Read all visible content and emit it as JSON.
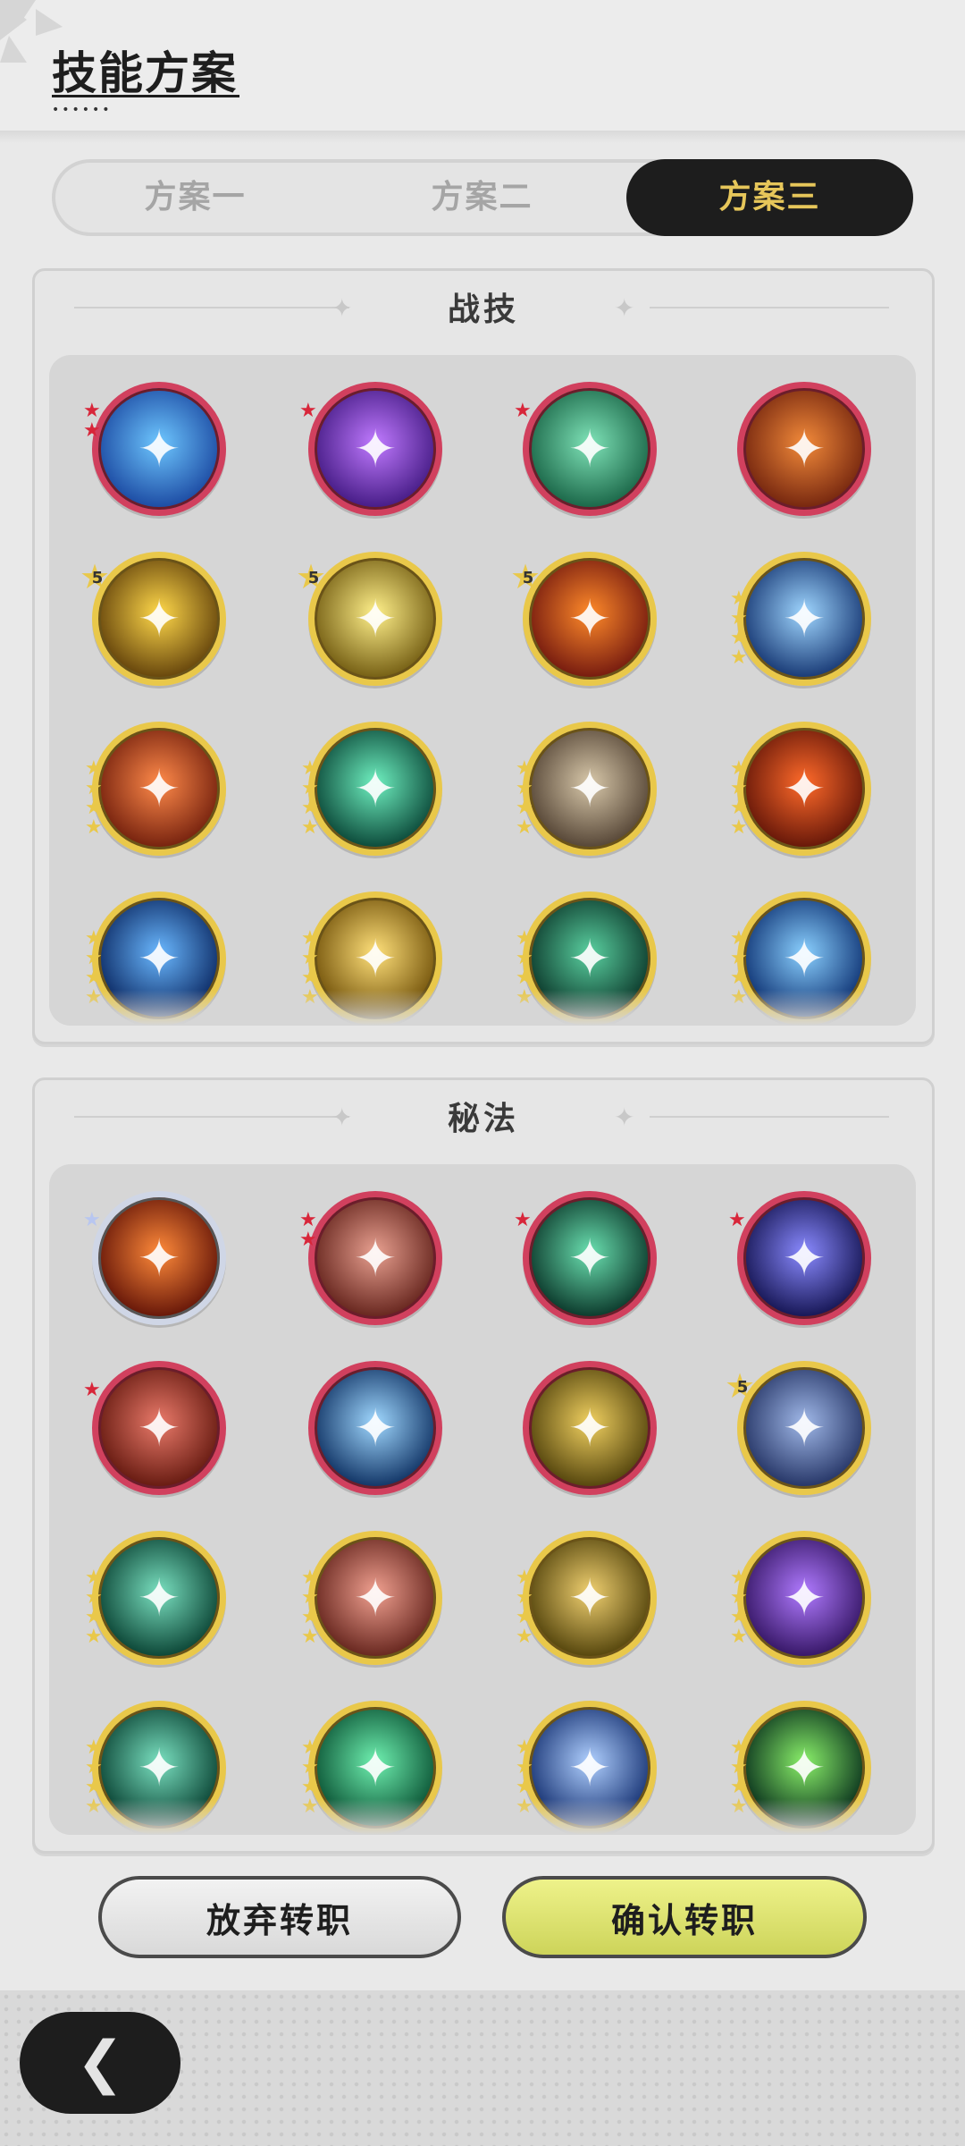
{
  "header": {
    "title": "技能方案"
  },
  "tabs": [
    {
      "label": "方案一",
      "active": false
    },
    {
      "label": "方案二",
      "active": false
    },
    {
      "label": "方案三",
      "active": true
    }
  ],
  "sections": {
    "combat": {
      "title": "战技",
      "skills": [
        {
          "name": "water-wave-skill-icon",
          "ring": "red",
          "badge": "red-star-2",
          "colors": [
            "#1f4fa6",
            "#6ec7ff"
          ]
        },
        {
          "name": "purple-lightning-skill-icon",
          "ring": "red",
          "badge": "red-star-1",
          "colors": [
            "#4a1f8a",
            "#c07aff"
          ]
        },
        {
          "name": "wind-vortex-skill-icon",
          "ring": "red",
          "badge": "red-star-1",
          "colors": [
            "#1e6b4c",
            "#7fe3b8"
          ]
        },
        {
          "name": "lava-burst-skill-icon",
          "ring": "red",
          "badge": "none",
          "colors": [
            "#7a2a10",
            "#f28a3a"
          ]
        },
        {
          "name": "golden-spike-skill-icon",
          "ring": "gold",
          "badge": "5",
          "colors": [
            "#6b4a0e",
            "#ffd84a"
          ]
        },
        {
          "name": "radiant-burst-skill-icon",
          "ring": "gold",
          "badge": "5",
          "colors": [
            "#7a6418",
            "#fff08a"
          ]
        },
        {
          "name": "fire-blast-skill-icon",
          "ring": "gold",
          "badge": "5",
          "colors": [
            "#7a1e10",
            "#ff8a2a"
          ]
        },
        {
          "name": "ice-shard-skill-icon",
          "ring": "gold",
          "badge": "gold-stars",
          "colors": [
            "#1d3f7a",
            "#9fd6ff"
          ]
        },
        {
          "name": "flame-eye-skill-icon",
          "ring": "gold",
          "badge": "gold-stars",
          "colors": [
            "#7a2510",
            "#ff8a4a"
          ]
        },
        {
          "name": "green-slash-skill-icon",
          "ring": "gold",
          "badge": "gold-stars",
          "colors": [
            "#0f4f3e",
            "#6ff0c0"
          ]
        },
        {
          "name": "rock-cards-skill-icon",
          "ring": "gold",
          "badge": "gold-stars",
          "colors": [
            "#5a4a3a",
            "#d8c8aa"
          ]
        },
        {
          "name": "fireball-skill-icon",
          "ring": "gold",
          "badge": "gold-stars",
          "colors": [
            "#6b1a0a",
            "#ff6a2a"
          ]
        },
        {
          "name": "blue-flame-skill-icon",
          "ring": "gold",
          "badge": "gold-stars",
          "colors": [
            "#10306b",
            "#6ab8ff"
          ]
        },
        {
          "name": "light-burst-skill-icon",
          "ring": "gold",
          "badge": "gold-stars",
          "colors": [
            "#7a5a10",
            "#ffe07a"
          ]
        },
        {
          "name": "thorn-vine-skill-icon",
          "ring": "gold",
          "badge": "gold-stars",
          "colors": [
            "#0f3f30",
            "#5ad0a0"
          ]
        },
        {
          "name": "crystal-shard-skill-icon",
          "ring": "gold",
          "badge": "gold-stars",
          "colors": [
            "#143a7a",
            "#8ad0ff"
          ]
        }
      ]
    },
    "arcane": {
      "title": "秘法",
      "skills": [
        {
          "name": "fire-orb-skill-icon",
          "ring": "silver",
          "badge": "silver-star",
          "colors": [
            "#6b1a0a",
            "#ff8a3a"
          ]
        },
        {
          "name": "healing-figure-skill-icon",
          "ring": "red",
          "badge": "red-star-2",
          "colors": [
            "#6b2a22",
            "#e8a090"
          ]
        },
        {
          "name": "green-spikes-skill-icon",
          "ring": "red",
          "badge": "red-star-1",
          "colors": [
            "#0f3f30",
            "#6ae0b0"
          ]
        },
        {
          "name": "clock-orb-skill-icon",
          "ring": "red",
          "badge": "red-star-1",
          "colors": [
            "#1a1a5a",
            "#8a8aff"
          ]
        },
        {
          "name": "demon-face-skill-icon",
          "ring": "red",
          "badge": "red-star-1",
          "colors": [
            "#6b1e14",
            "#ea7a6a"
          ]
        },
        {
          "name": "ice-crystal-skill-icon",
          "ring": "red",
          "badge": "none",
          "colors": [
            "#163a6b",
            "#a0d8ff"
          ]
        },
        {
          "name": "golden-shield-skill-icon",
          "ring": "red",
          "badge": "none",
          "colors": [
            "#5a4a10",
            "#f0d060"
          ]
        },
        {
          "name": "armor-skill-icon",
          "ring": "gold",
          "badge": "5",
          "colors": [
            "#2a3a6b",
            "#a0b8e8"
          ]
        },
        {
          "name": "green-shield-skill-icon",
          "ring": "gold",
          "badge": "gold-stars",
          "colors": [
            "#0f4a3a",
            "#7ae0c0"
          ]
        },
        {
          "name": "swirl-skill-icon",
          "ring": "gold",
          "badge": "gold-stars",
          "colors": [
            "#6b2a22",
            "#f0a090"
          ]
        },
        {
          "name": "bird-skill-icon",
          "ring": "gold",
          "badge": "gold-stars",
          "colors": [
            "#5a4a10",
            "#f0d070"
          ]
        },
        {
          "name": "purple-swirl-skill-icon",
          "ring": "gold",
          "badge": "gold-stars",
          "colors": [
            "#3a1a6b",
            "#b07aff"
          ]
        },
        {
          "name": "green-star-orb-skill-icon",
          "ring": "gold",
          "badge": "gold-stars",
          "colors": [
            "#0f4a3a",
            "#7ae0c0"
          ]
        },
        {
          "name": "green-figure-skill-icon",
          "ring": "gold",
          "badge": "gold-stars",
          "colors": [
            "#0f5a3a",
            "#6ff0b0"
          ]
        },
        {
          "name": "star-sparkle-skill-icon",
          "ring": "gold",
          "badge": "gold-stars",
          "colors": [
            "#1e3a7a",
            "#b0d0ff"
          ]
        },
        {
          "name": "green-claw-skill-icon",
          "ring": "gold",
          "badge": "gold-stars",
          "colors": [
            "#0f3a20",
            "#8af06a"
          ]
        }
      ]
    }
  },
  "buttons": {
    "abandon": "放弃转职",
    "confirm": "确认转职"
  }
}
